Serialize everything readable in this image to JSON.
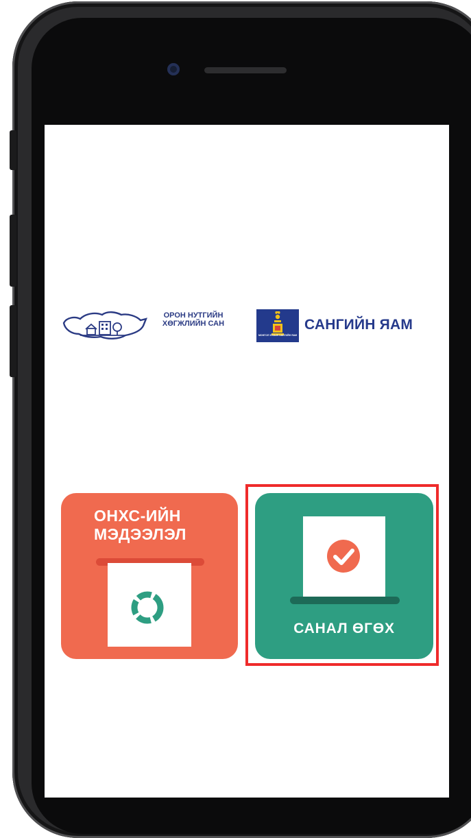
{
  "logos": {
    "fund_name": "ОРОН НУТГИЙН ХӨГЖЛИЙН САН",
    "ministry_emblem_caption": "МОНГОЛ УЛСЫН САНГИЙН ЯАМ",
    "ministry_name": "САНГИЙН ЯАМ"
  },
  "tiles": {
    "info": {
      "label": "ОНХС-ИЙН МЭДЭЭЛЭЛ",
      "icon": "ring-icon",
      "color": "#f06a4f"
    },
    "vote": {
      "label": "САНАЛ ӨГӨХ",
      "icon": "check-circle-icon",
      "color": "#2e9e82"
    }
  },
  "highlight": {
    "target": "vote",
    "color": "#ef2b2b"
  }
}
